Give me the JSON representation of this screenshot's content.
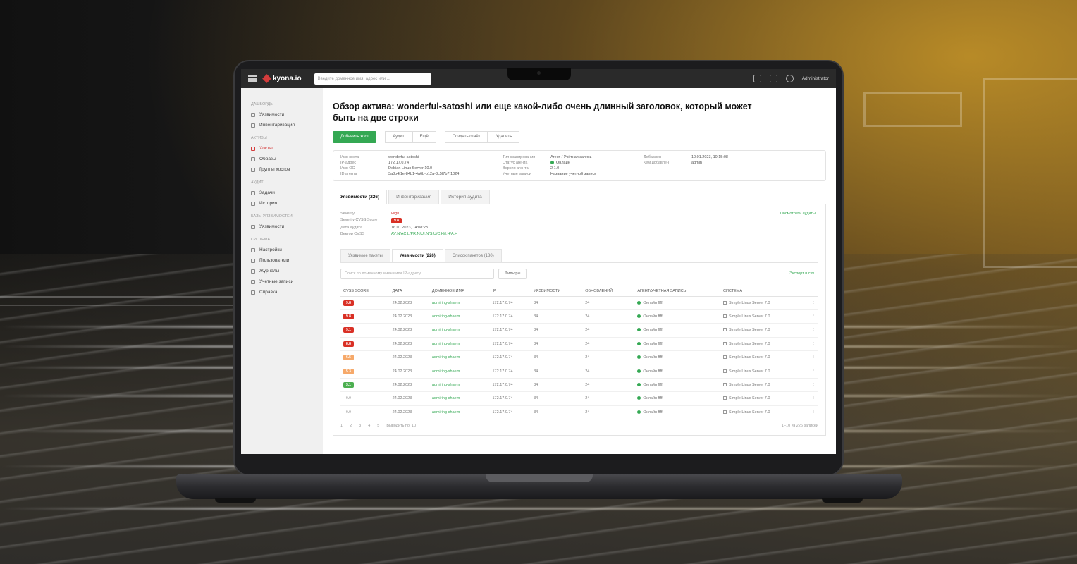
{
  "app": {
    "logo_text": "kyona.io",
    "search_placeholder": "Введите доменное имя, адрес или ...",
    "user_name": "Administrator"
  },
  "sidebar": {
    "sections": [
      {
        "title": "Дашборды",
        "items": [
          {
            "label": "Уязвимости"
          },
          {
            "label": "Инвентаризация"
          }
        ]
      },
      {
        "title": "Активы",
        "items": [
          {
            "label": "Хосты",
            "active": true
          },
          {
            "label": "Образы"
          },
          {
            "label": "Группы хостов"
          }
        ]
      },
      {
        "title": "Аудит",
        "items": [
          {
            "label": "Задачи"
          },
          {
            "label": "История"
          }
        ]
      },
      {
        "title": "Базы уязвимостей",
        "items": [
          {
            "label": "Уязвимости"
          }
        ]
      },
      {
        "title": "Система",
        "items": [
          {
            "label": "Настройки"
          },
          {
            "label": "Пользователи"
          },
          {
            "label": "Журналы"
          },
          {
            "label": "Учетные записи"
          },
          {
            "label": "Справка"
          }
        ]
      }
    ]
  },
  "page": {
    "title": "Обзор актива: wonderful-satoshi или еще какой-либо очень длинный заголовок, который может быть на две строки",
    "actions": {
      "primary": "Добавить хост",
      "group": [
        "Аудит",
        "Ещё"
      ],
      "secondary": [
        "Создать отчёт",
        "Удалить"
      ]
    },
    "info": {
      "col1": [
        {
          "k": "Имя хоста",
          "v": "wonderful-satoshi"
        },
        {
          "k": "IP-адрес",
          "v": "172.17.0.74"
        },
        {
          "k": "Имя ОС",
          "v": "Debian Linux Server 10.0"
        },
        {
          "k": "ID агента",
          "v": "3a8b4f1e-84b1-4a6b-b12a-3c5f7b7f1024"
        }
      ],
      "col2": [
        {
          "k": "Тип сканирования",
          "v": "Агент / Учётная запись"
        },
        {
          "k": "Статус агента",
          "v": "Онлайн"
        },
        {
          "k": "Версия агента",
          "v": "2.1.0"
        },
        {
          "k": "Учетные записи",
          "v": "Название учетной записи"
        }
      ],
      "col3": [
        {
          "k": "Добавлен",
          "v": "10.01.2023, 10:15:08"
        },
        {
          "k": "Кем добавлен",
          "v": "admin"
        }
      ]
    },
    "tabs": [
      {
        "label": "Уязвимости (226)",
        "active": true
      },
      {
        "label": "Инвентаризация"
      },
      {
        "label": "История аудита"
      }
    ],
    "summary": {
      "link": "Посмотреть аудиты",
      "rows": [
        {
          "k": "Severity",
          "v": "High",
          "tone": "red"
        },
        {
          "k": "Severity CVSS Score",
          "badge": "9.8"
        },
        {
          "k": "Дата аудита",
          "v": "16.01.2023, 14:08:23"
        },
        {
          "k": "Вектор CVSS",
          "v": "AV:N/AC:L/PR:N/UI:N/S:U/C:H/I:H/A:H",
          "tone": "green"
        }
      ]
    },
    "subtabs": [
      {
        "label": "Уязвимые пакеты"
      },
      {
        "label": "Уязвимости (226)",
        "active": true
      },
      {
        "label": "Список пакетов (180)"
      }
    ],
    "filter": {
      "placeholder": "Поиск по доменному имени или IP-адресу",
      "filter_label": "Фильтры",
      "export_label": "Экспорт в csv"
    },
    "table": {
      "headers": [
        "CVSS SCORE",
        "ДАТА",
        "ДОМЕННОЕ ИМЯ",
        "IP",
        "УЯЗВИМОСТИ",
        "ОБНОВЛЕНИЙ",
        "АГЕНТ/УЧЕТНАЯ ЗАПИСЬ",
        "СИСТЕМА"
      ],
      "rows": [
        {
          "score": "9.8",
          "sev": "critical",
          "date": "24.02.2023",
          "domain": "admiring-shaem",
          "ip": "172.17.0.74",
          "vulns": "34",
          "updates": "24",
          "agent": "Онлайн",
          "acc": "ffffl",
          "system": "Simple Linux Server 7.0"
        },
        {
          "score": "9.8",
          "sev": "critical",
          "date": "24.02.2023",
          "domain": "admiring-shaem",
          "ip": "172.17.0.74",
          "vulns": "34",
          "updates": "24",
          "agent": "Онлайн",
          "acc": "ffffl",
          "system": "Simple Linux Server 7.0"
        },
        {
          "score": "9.1",
          "sev": "critical",
          "date": "24.02.2023",
          "domain": "admiring-shaem",
          "ip": "172.17.0.74",
          "vulns": "34",
          "updates": "24",
          "agent": "Онлайн",
          "acc": "ffffl",
          "system": "Simple Linux Server 7.0"
        },
        {
          "score": "8.8",
          "sev": "critical",
          "date": "24.02.2023",
          "domain": "admiring-shaem",
          "ip": "172.17.0.74",
          "vulns": "34",
          "updates": "24",
          "agent": "Онлайн",
          "acc": "ffffl",
          "system": "Simple Linux Server 7.0"
        },
        {
          "score": "6.5",
          "sev": "medium",
          "date": "24.02.2023",
          "domain": "admiring-shaem",
          "ip": "172.17.0.74",
          "vulns": "34",
          "updates": "24",
          "agent": "Онлайн",
          "acc": "ffffl",
          "system": "Simple Linux Server 7.0"
        },
        {
          "score": "5.3",
          "sev": "medium",
          "date": "24.02.2023",
          "domain": "admiring-shaem",
          "ip": "172.17.0.74",
          "vulns": "34",
          "updates": "24",
          "agent": "Онлайн",
          "acc": "ffffl",
          "system": "Simple Linux Server 7.0"
        },
        {
          "score": "3.1",
          "sev": "low",
          "date": "24.02.2023",
          "domain": "admiring-shaem",
          "ip": "172.17.0.74",
          "vulns": "34",
          "updates": "24",
          "agent": "Онлайн",
          "acc": "ffffl",
          "system": "Simple Linux Server 7.0"
        },
        {
          "score": "0.0",
          "sev": "none",
          "date": "24.02.2023",
          "domain": "admiring-shaem",
          "ip": "172.17.0.74",
          "vulns": "34",
          "updates": "24",
          "agent": "Онлайн",
          "acc": "ffffl",
          "system": "Simple Linux Server 7.0"
        },
        {
          "score": "0.0",
          "sev": "none",
          "date": "24.02.2023",
          "domain": "admiring-shaem",
          "ip": "172.17.0.74",
          "vulns": "34",
          "updates": "24",
          "agent": "Онлайн",
          "acc": "ffffl",
          "system": "Simple Linux Server 7.0"
        }
      ]
    },
    "pager": {
      "pages": [
        "1",
        "2",
        "3",
        "4",
        "5"
      ],
      "per_page": "Выводить по: 10",
      "count": "1–10 из 226 записей"
    }
  },
  "colors": {
    "accent": "#34a853",
    "danger": "#d93025",
    "topbar": "#2a2a2a"
  }
}
